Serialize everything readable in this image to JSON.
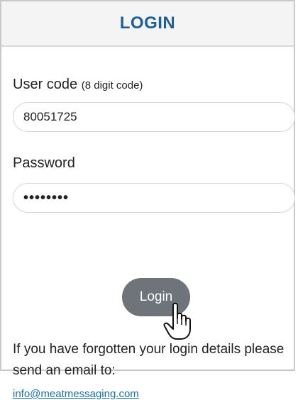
{
  "header": {
    "title": "LOGIN"
  },
  "form": {
    "user_code_label": "User code",
    "user_code_hint": "(8 digit code)",
    "user_code_value": "80051725",
    "password_label": "Password",
    "password_value": "••••••••",
    "login_button": "Login"
  },
  "info": {
    "text": "If you have forgotten your login details please send an email to:",
    "email": "info@meatmessaging.com"
  },
  "colors": {
    "title": "#1f5f99",
    "button": "#6e7479",
    "link": "#1a6fa8"
  },
  "icons": {
    "cursor": "hand-pointer-icon"
  }
}
